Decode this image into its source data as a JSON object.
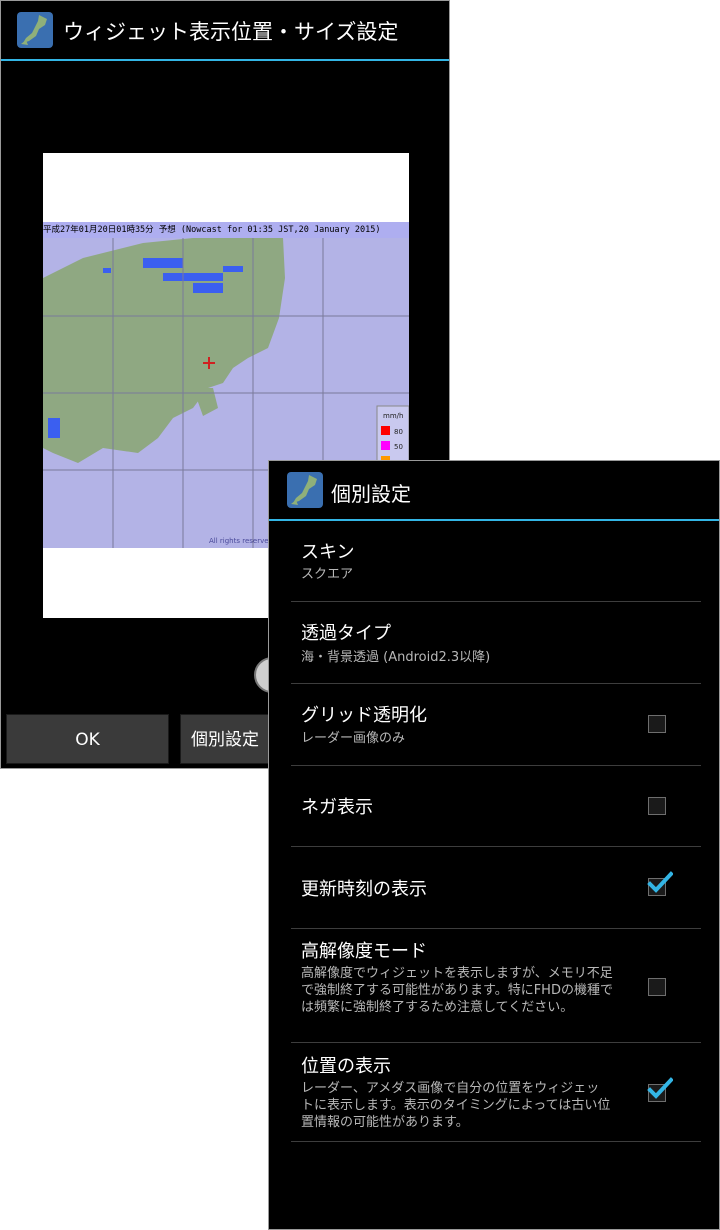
{
  "back_window": {
    "title": "ウィジェット表示位置・サイズ設定",
    "map_caption": "平成27年01月20日01時35分 予想 (Nowcast for 01:35 JST,20 January 2015)",
    "legend_unit": "mm/h",
    "legend_values": [
      "80",
      "50"
    ],
    "copyright": "All rights reserved",
    "buttons": {
      "ok": "OK",
      "individual": "個別設定"
    }
  },
  "dialog": {
    "title": "個別設定",
    "items": [
      {
        "title": "スキン",
        "summary": "スクエア",
        "checkbox": null
      },
      {
        "title": "透過タイプ",
        "summary": "海・背景透過 (Android2.3以降)",
        "checkbox": null
      },
      {
        "title": "グリッド透明化",
        "summary": "レーダー画像のみ",
        "checkbox": false
      },
      {
        "title": "ネガ表示",
        "summary": "",
        "checkbox": false
      },
      {
        "title": "更新時刻の表示",
        "summary": "",
        "checkbox": true
      },
      {
        "title": "高解像度モード",
        "summary": "高解像度でウィジェットを表示しますが、メモリ不足で強制終了する可能性があります。特にFHDの機種では頻繁に強制終了するため注意してください。",
        "checkbox": false
      },
      {
        "title": "位置の表示",
        "summary": "レーダー、アメダス画像で自分の位置をウィジェットに表示します。表示のタイミングによっては古い位置情報の可能性があります。",
        "checkbox": true
      }
    ]
  },
  "colors": {
    "accent": "#33b5e5",
    "check": "#33b5e5",
    "sea": "#b3b3e6",
    "land": "#8fa882"
  },
  "icons": {
    "app": "japan-map-icon"
  }
}
